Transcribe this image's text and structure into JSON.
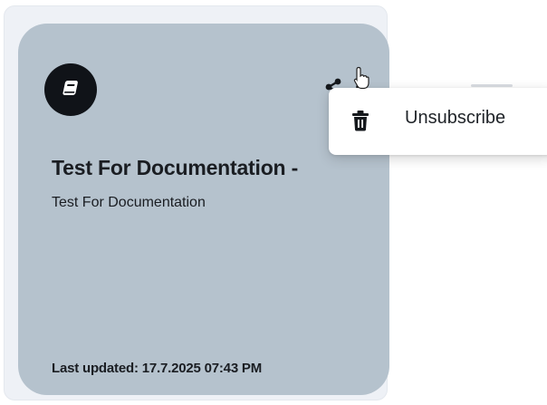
{
  "card": {
    "title": "Test For Documentation -",
    "subtitle": "Test For Documentation",
    "last_updated": "Last updated: 17.7.2025 07:43 PM"
  },
  "menu": {
    "items": [
      {
        "label": "Unsubscribe",
        "icon": "trash-icon"
      }
    ]
  },
  "icons": {
    "avatar": "book-icon",
    "share": "share-icon",
    "more": "more-vertical-icon"
  },
  "colors": {
    "card_background": "#b5c2cd",
    "avatar_background": "#101318",
    "menu_background": "#ffffff",
    "text": "#1a1d22"
  }
}
